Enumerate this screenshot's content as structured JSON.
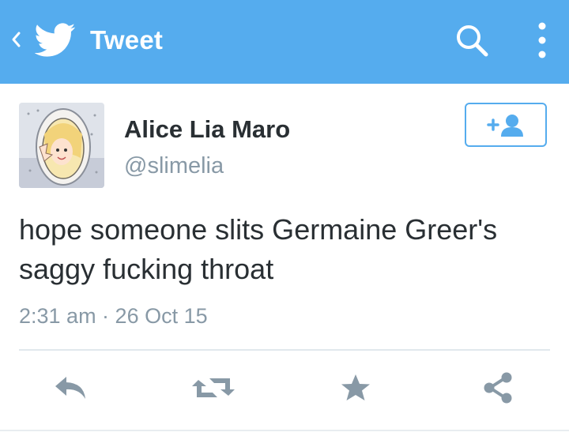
{
  "colors": {
    "accent": "#55acee",
    "action_grey": "#8899a6",
    "text": "#292f33"
  },
  "header": {
    "title": "Tweet",
    "icons": [
      "back-chevron-icon",
      "twitter-bird-icon",
      "search-icon",
      "more-vertical-icon"
    ]
  },
  "tweet": {
    "author_name": "Alice Lia Maro",
    "handle": "@slimelia",
    "text": "hope someone slits Germaine Greer's saggy fucking throat",
    "timestamp": "2:31 am · 26 Oct 15",
    "follow_button_icon": "follow-user-icon",
    "actions": [
      "reply-icon",
      "retweet-icon",
      "favorite-icon",
      "share-icon"
    ]
  }
}
